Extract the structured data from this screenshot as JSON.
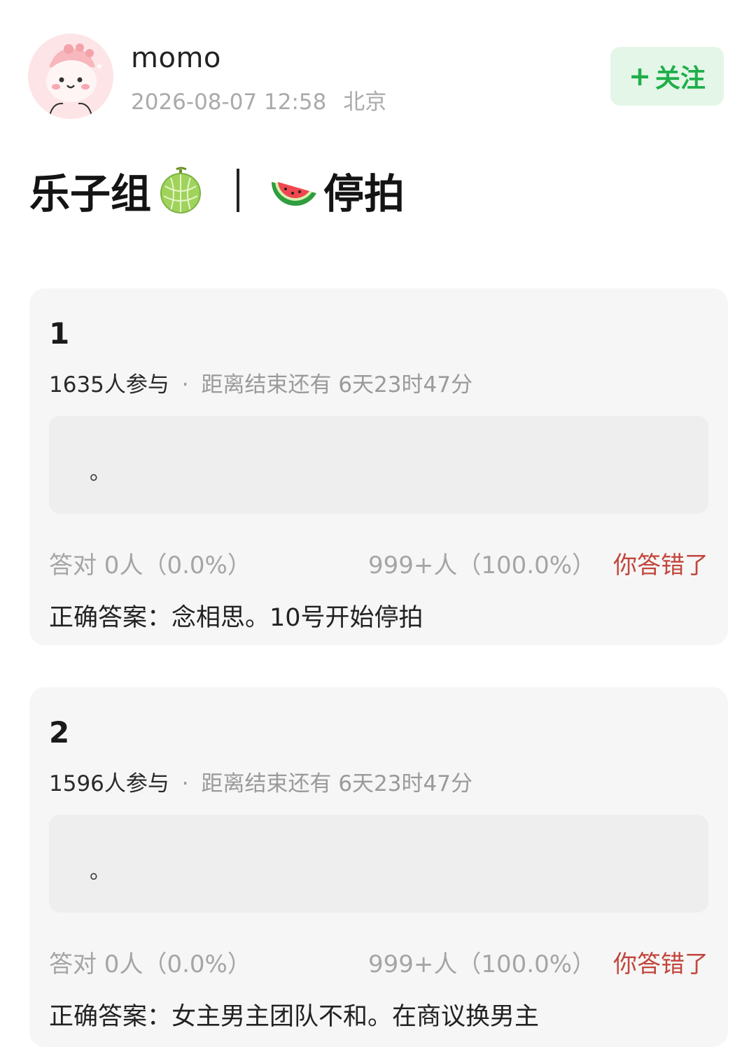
{
  "post": {
    "username": "momo",
    "datetime": "2026-08-07 12:58",
    "location": "北京",
    "follow_icon": "+",
    "follow_label": "关注",
    "title_part1": "乐子组",
    "title_part2": "停拍",
    "title_emoji1": "melon-emoji",
    "title_emoji2": "watermelon-emoji"
  },
  "quizzes": [
    {
      "number": "1",
      "participants": "1635人参与",
      "separator": "·",
      "time_left": "距离结束还有 6天23时47分",
      "option_text": "。",
      "correct_stat": "答对 0人（0.0%）",
      "other_stat": "999+人（100.0%）",
      "result": "你答错了",
      "answer": "正确答案：念相思。10号开始停拍"
    },
    {
      "number": "2",
      "participants": "1596人参与",
      "separator": "·",
      "time_left": "距离结束还有 6天23时47分",
      "option_text": "。",
      "correct_stat": "答对 0人（0.0%）",
      "other_stat": "999+人（100.0%）",
      "result": "你答错了",
      "answer": "正确答案：女主男主团队不和。在商议换男主"
    }
  ],
  "colors": {
    "follow_bg": "#e3f6e7",
    "follow_text": "#1fae4a",
    "wrong_text": "#c2463c",
    "card_bg": "#f6f6f6",
    "option_bg": "#eeeeee"
  }
}
